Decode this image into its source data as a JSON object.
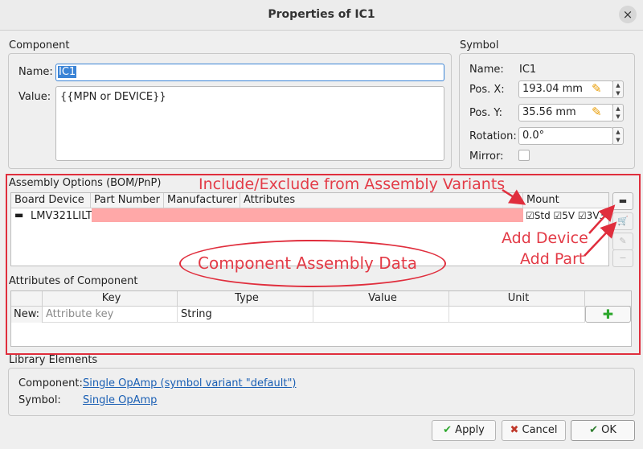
{
  "window": {
    "title": "Properties of IC1",
    "close_glyph": "×"
  },
  "component": {
    "group_title": "Component",
    "name_label": "Name:",
    "name_value": "IC1",
    "value_label": "Value:",
    "value_text": "{{MPN or DEVICE}}"
  },
  "symbol": {
    "group_title": "Symbol",
    "name_label": "Name:",
    "name_value": "IC1",
    "posx_label": "Pos. X:",
    "posx_value": "193.04 mm",
    "posy_label": "Pos. Y:",
    "posy_value": "35.56 mm",
    "rotation_label": "Rotation:",
    "rotation_value": "0.0°",
    "mirror_label": "Mirror:",
    "mirror_checked": false
  },
  "assembly": {
    "group_title": "Assembly Options (BOM/PnP)",
    "columns": [
      "Board Device",
      "Part Number",
      "Manufacturer",
      "Attributes",
      "Mount"
    ],
    "row": {
      "device": "LMV321LILT",
      "mount": "☑Std ☑5V ☑3V3"
    },
    "highlight_color": "#ffa8a8"
  },
  "attributes": {
    "group_title": "Attributes of Component",
    "columns": [
      "Key",
      "Type",
      "Value",
      "Unit"
    ],
    "new_label": "New:",
    "key_placeholder": "Attribute key",
    "type_value": "String",
    "add_glyph": "✚"
  },
  "library": {
    "group_title": "Library Elements",
    "component_label": "Component:",
    "component_link": "Single OpAmp (symbol variant \"default\")",
    "symbol_label": "Symbol:",
    "symbol_link": "Single OpAmp"
  },
  "buttons": {
    "apply": "Apply",
    "cancel": "Cancel",
    "ok": "OK"
  },
  "annotations": {
    "variants": "Include/Exclude from Assembly Variants",
    "add_device": "Add Device",
    "add_part": "Add Part",
    "assembly_data": "Component Assembly Data",
    "color": "#e02e3d"
  }
}
